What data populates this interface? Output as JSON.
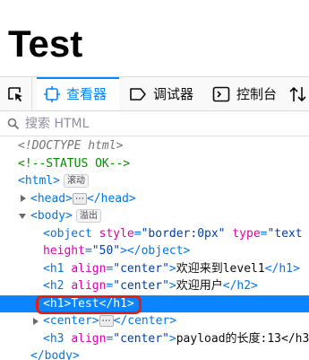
{
  "page": {
    "heading": "Test"
  },
  "toolbar": {
    "tabs": [
      {
        "label": "查看器",
        "icon": "inspector-icon"
      },
      {
        "label": "调试器",
        "icon": "debugger-icon"
      },
      {
        "label": "控制台",
        "icon": "console-icon"
      }
    ],
    "picker_icon": "element-picker-icon",
    "extra_icon": "sort-arrows-icon"
  },
  "search": {
    "placeholder": "搜索 HTML"
  },
  "tree": {
    "doctype": "<!DOCTYPE html>",
    "status_comment": "<!--STATUS OK-->",
    "html_open": "<html>",
    "html_badge": "滚动",
    "head": {
      "open": "<head>",
      "close": "</head>",
      "ellipsis": "⋯"
    },
    "body_open": "<body>",
    "body_badge": "溢出",
    "object_line1": {
      "open": "<object",
      "style_attr": "style",
      "style_val": "\"border:0px\"",
      "type_attr": "type",
      "type_val": "\"text"
    },
    "object_line2": {
      "height_attr": "height",
      "height_val": "\"50\"",
      "close": "></object>"
    },
    "h1_welcome": {
      "open": "<h1",
      "attr": "align",
      "val": "\"center\"",
      "gt": ">",
      "text": "欢迎来到level1",
      "close": "</h1>"
    },
    "h2_user": {
      "open": "<h2",
      "attr": "align",
      "val": "\"center\"",
      "gt": ">",
      "text": "欢迎用户",
      "close": "</h2>"
    },
    "h1_test": {
      "open": "<h1>",
      "text": "Test",
      "close": "</h1>"
    },
    "center": {
      "open": "<center>",
      "ellipsis": "⋯",
      "close": "</center>"
    },
    "h3_payload": {
      "open": "<h3",
      "attr": "align",
      "val": "\"center\"",
      "gt": ">",
      "text": "payload的长度:13</h3"
    },
    "body_close": "</body>"
  },
  "colors": {
    "accent": "#0a84ff",
    "selection": "#0a84ff",
    "highlight_border": "#e0201b",
    "tag": "#0074e8",
    "attr_name": "#dd00a9",
    "attr_value": "#003eaa",
    "comment": "#058b00"
  }
}
